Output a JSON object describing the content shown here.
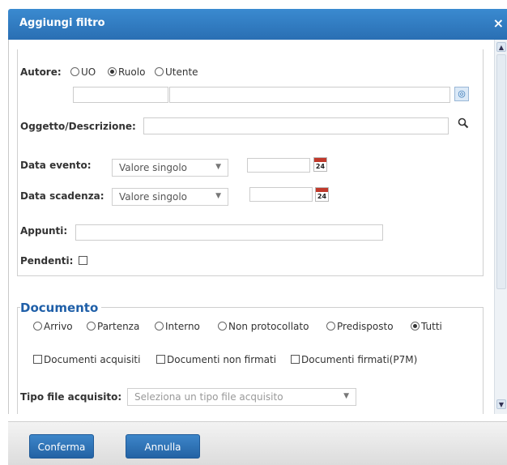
{
  "dialog": {
    "title": "Aggiungi filtro",
    "close": "×"
  },
  "autore": {
    "label": "Autore:",
    "options": [
      {
        "label": "UO",
        "selected": false
      },
      {
        "label": "Ruolo",
        "selected": true
      },
      {
        "label": "Utente",
        "selected": false
      }
    ]
  },
  "oggetto": {
    "label": "Oggetto/Descrizione:"
  },
  "data_evento": {
    "label": "Data evento:",
    "select_value": "Valore singolo",
    "calendar_day": "24"
  },
  "data_scadenza": {
    "label": "Data scadenza:",
    "select_value": "Valore singolo",
    "calendar_day": "24"
  },
  "appunti": {
    "label": "Appunti:"
  },
  "pendenti": {
    "label": "Pendenti:"
  },
  "documento": {
    "title": "Documento",
    "types": [
      {
        "label": "Arrivo",
        "selected": false
      },
      {
        "label": "Partenza",
        "selected": false
      },
      {
        "label": "Interno",
        "selected": false
      },
      {
        "label": "Non protocollato",
        "selected": false
      },
      {
        "label": "Predisposto",
        "selected": false
      },
      {
        "label": "Tutti",
        "selected": true
      }
    ],
    "checks": [
      {
        "label": "Documenti acquisiti"
      },
      {
        "label": "Documenti non firmati"
      },
      {
        "label": "Documenti firmati(P7M)"
      }
    ],
    "tipo_file_label": "Tipo file acquisito:",
    "tipo_file_placeholder": "Seleziona un tipo file acquisito"
  },
  "footer": {
    "confirm": "Conferma",
    "cancel": "Annulla"
  },
  "icons": {
    "radio_selected": "radio-selected",
    "search": "magnifier",
    "calendar": "calendar",
    "chevron": "▼"
  }
}
